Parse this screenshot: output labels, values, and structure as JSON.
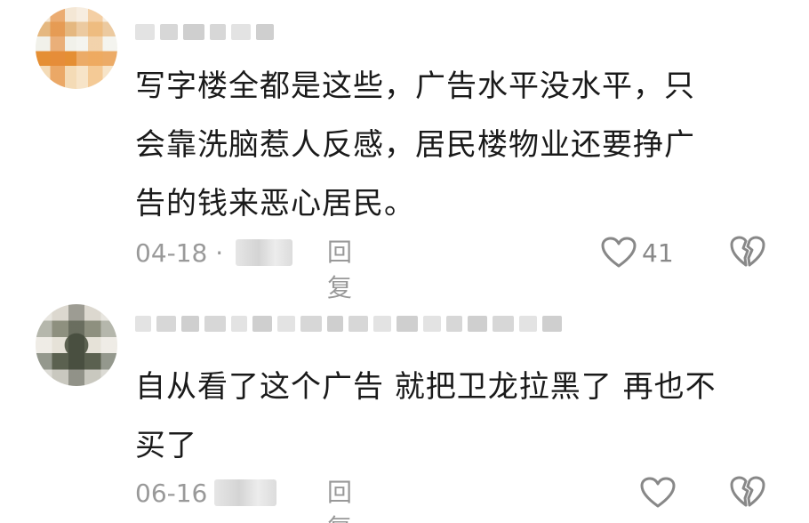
{
  "comments": [
    {
      "lines": [
        "写字楼全都是这些，广告水平没水平，只",
        "会靠洗脑惹人反感，居民楼物业还要挣广",
        "告的钱来恶心居民。"
      ],
      "date": "04-18 ·",
      "reply_label": "回复",
      "like_count": "41",
      "like_icon": "heart-outline-icon",
      "dislike_icon": "broken-heart-icon"
    },
    {
      "lines": [
        "自从看了这个广告 就把卫龙拉黑了 再也不",
        "买了"
      ],
      "date": "06-16",
      "reply_label": "回复",
      "like_count": "",
      "like_icon": "heart-outline-icon",
      "dislike_icon": "broken-heart-icon"
    }
  ],
  "colors": {
    "text": "#1a1a1a",
    "meta": "#999999",
    "icon": "#888888"
  }
}
